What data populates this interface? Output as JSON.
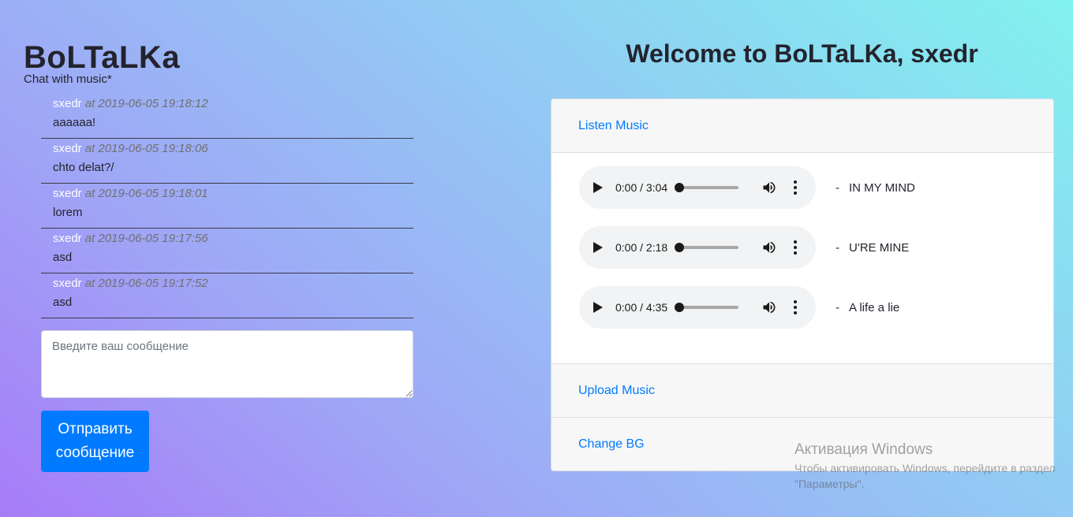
{
  "brand": {
    "title": "BoLTaLKa",
    "subtitle": "Chat with music*"
  },
  "chat": {
    "messages": [
      {
        "user": "sxedr",
        "time": "at 2019-06-05 19:18:12",
        "text": "aaaaaa!"
      },
      {
        "user": "sxedr",
        "time": "at 2019-06-05 19:18:06",
        "text": "chto delat?/"
      },
      {
        "user": "sxedr",
        "time": "at 2019-06-05 19:18:01",
        "text": "lorem"
      },
      {
        "user": "sxedr",
        "time": "at 2019-06-05 19:17:56",
        "text": "asd"
      },
      {
        "user": "sxedr",
        "time": "at 2019-06-05 19:17:52",
        "text": "asd"
      }
    ],
    "input_placeholder": "Введите ваш сообщение",
    "input_value": "",
    "send_label": "Отправить сообщение"
  },
  "welcome": "Welcome to BoLTaLKa, sxedr",
  "music": {
    "listen_label": "Listen Music",
    "tracks": [
      {
        "time": "0:00 / 3:04",
        "dash": "-",
        "name": "IN MY MIND"
      },
      {
        "time": "0:00 / 2:18",
        "dash": "-",
        "name": "U'RE MINE"
      },
      {
        "time": "0:00 / 4:35",
        "dash": "-",
        "name": "A life a lie"
      }
    ],
    "upload_label": "Upload Music",
    "change_bg_label": "Change BG"
  },
  "windows_activation": {
    "title": "Активация Windows",
    "text": "Чтобы активировать Windows, перейдите в раздел \"Параметры\"."
  },
  "colors": {
    "accent": "#007bff",
    "username": "#ffffff",
    "timestamp": "#707070"
  },
  "icons": [
    "play-icon",
    "volume-icon",
    "more-vert-icon"
  ]
}
